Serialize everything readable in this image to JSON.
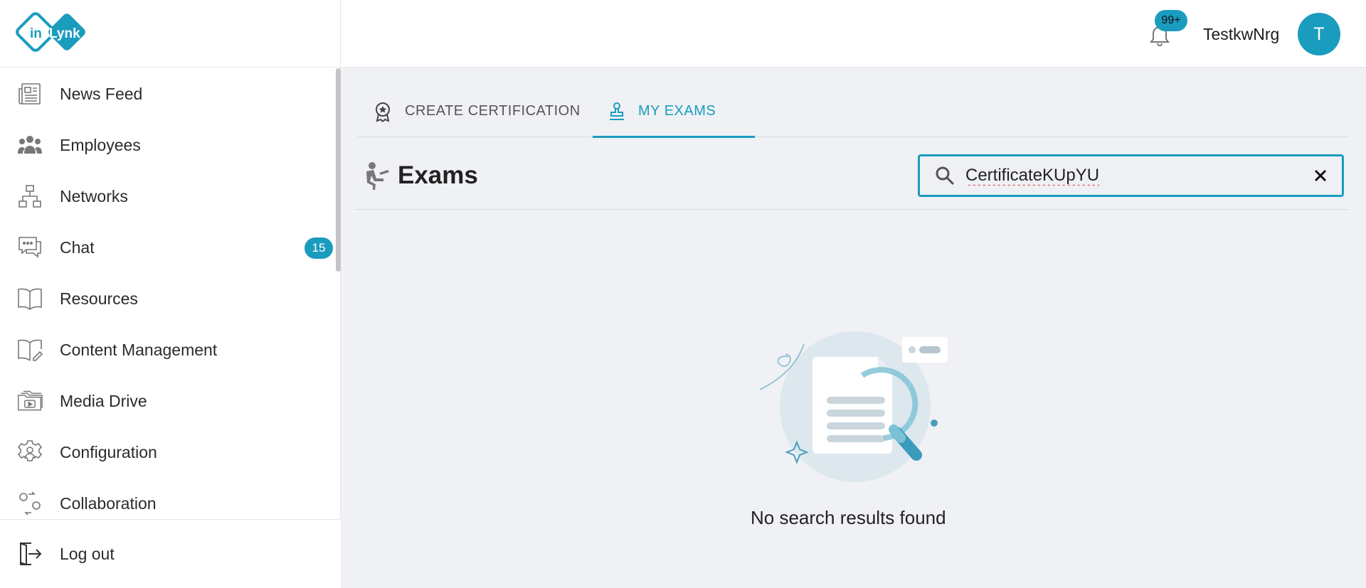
{
  "brand": {
    "logo_left": "in",
    "logo_right": "Lynk",
    "color": "#1a9cbe"
  },
  "sidebar": {
    "items": [
      {
        "label": "News Feed",
        "icon": "newspaper-icon"
      },
      {
        "label": "Employees",
        "icon": "people-icon"
      },
      {
        "label": "Networks",
        "icon": "network-icon"
      },
      {
        "label": "Chat",
        "icon": "chat-icon",
        "badge": "15"
      },
      {
        "label": "Resources",
        "icon": "book-icon"
      },
      {
        "label": "Content Management",
        "icon": "edit-book-icon"
      },
      {
        "label": "Media Drive",
        "icon": "folder-media-icon"
      },
      {
        "label": "Configuration",
        "icon": "gear-user-icon"
      },
      {
        "label": "Collaboration",
        "icon": "collaboration-icon"
      }
    ],
    "logout_label": "Log out"
  },
  "header": {
    "notification_count": "99+",
    "username": "TestkwNrg",
    "avatar_initial": "T"
  },
  "tabs": [
    {
      "label": "CREATE CERTIFICATION",
      "icon": "award-icon",
      "active": false
    },
    {
      "label": "MY EXAMS",
      "icon": "stamp-icon",
      "active": true
    }
  ],
  "exams": {
    "title": "Exams",
    "search_value": "CertificateKUpYU"
  },
  "empty_state": {
    "message": "No search results found"
  }
}
